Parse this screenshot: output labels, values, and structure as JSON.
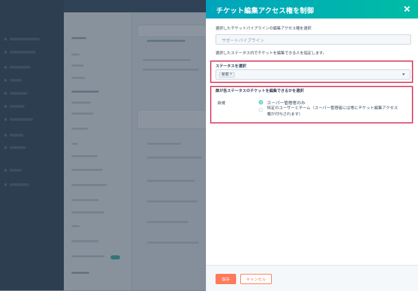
{
  "panel": {
    "title": "チケット編集アクセス権を制御",
    "pipeline_label": "選択したチケットパイプラインの編集アクセス権を選択",
    "pipeline_value": "サポートパイプライン",
    "status_instruction": "選択したステータス内でチケットを編集できる人を指定します。",
    "status_section_title": "ステータスを選択",
    "selected_status_tag": "新規",
    "permission_section_title": "誰が各ステータスのチケットを編集できるかを選択",
    "status_row_label": "新規",
    "option_super_admin": "スーパー管理者のみ",
    "option_specific_line1": "特定のユーザーとチーム（スーパー管理者には常にチケット編集アクセス",
    "option_specific_line2": "権が付与されます）",
    "save_label": "保存",
    "cancel_label": "キャンセル"
  },
  "icons": {
    "close": "close-icon",
    "tag_remove": "x",
    "dropdown": "chevron-down-icon"
  },
  "colors": {
    "header_start": "#00a4bd",
    "header_end": "#00bda5",
    "highlight_box": "#e05c7a",
    "primary_button": "#ff7a59",
    "radio_selected": "#00bda5"
  }
}
